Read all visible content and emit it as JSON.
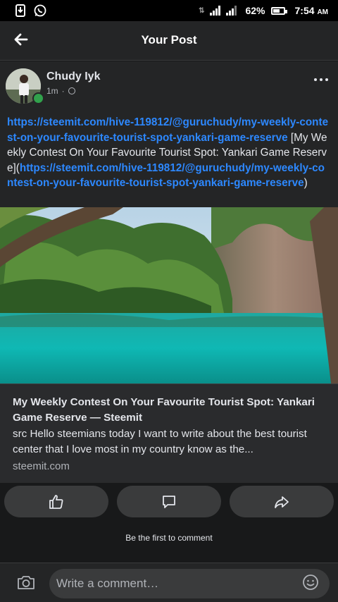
{
  "status_bar": {
    "icons": [
      "download-icon",
      "whatsapp-icon",
      "data-arrows-icon",
      "signal-icon",
      "signal-icon",
      "battery-icon"
    ],
    "battery": "62%",
    "battery_level": 0.62,
    "time": "7:54",
    "ampm": "AM"
  },
  "header": {
    "title": "Your Post",
    "back_icon": "arrow-left-icon"
  },
  "post": {
    "author": "Chudy Iyk",
    "time": "1m",
    "visibility_icon": "globe-icon",
    "more_icon": "more-horizontal-icon",
    "text": {
      "link1": "https://steemit.com/hive-119812/@guruchudy/my-weekly-contest-on-your-favourite-tourist-spot-yankari-game-reserve",
      "bracket_text": " [My Weekly Contest On Your Favourite Tourist Spot: Yankari Game Reserve](",
      "link2": "https://steemit.com/hive-119812/@guruchudy/my-weekly-contest-on-your-favourite-tourist-spot-yankari-game-reserve",
      "close": ")"
    },
    "link_preview": {
      "title": "My Weekly Contest On Your Favourite Tourist Spot: Yankari Game Reserve — Steemit",
      "description": "src Hello steemians today I want to write about the best tourist center that I love most in my country know as the...",
      "domain": "steemit.com"
    }
  },
  "actions": [
    {
      "icon": "like-icon"
    },
    {
      "icon": "comment-icon"
    },
    {
      "icon": "share-icon"
    }
  ],
  "comments": {
    "empty_text": "Be the first to comment"
  },
  "composer": {
    "placeholder": "Write a comment…",
    "camera_icon": "camera-icon",
    "emoji_icon": "emoji-icon"
  },
  "colors": {
    "background": "#18191a",
    "card": "#242526",
    "link": "#2d88ff",
    "button": "#3a3b3c",
    "online": "#31a24c"
  }
}
